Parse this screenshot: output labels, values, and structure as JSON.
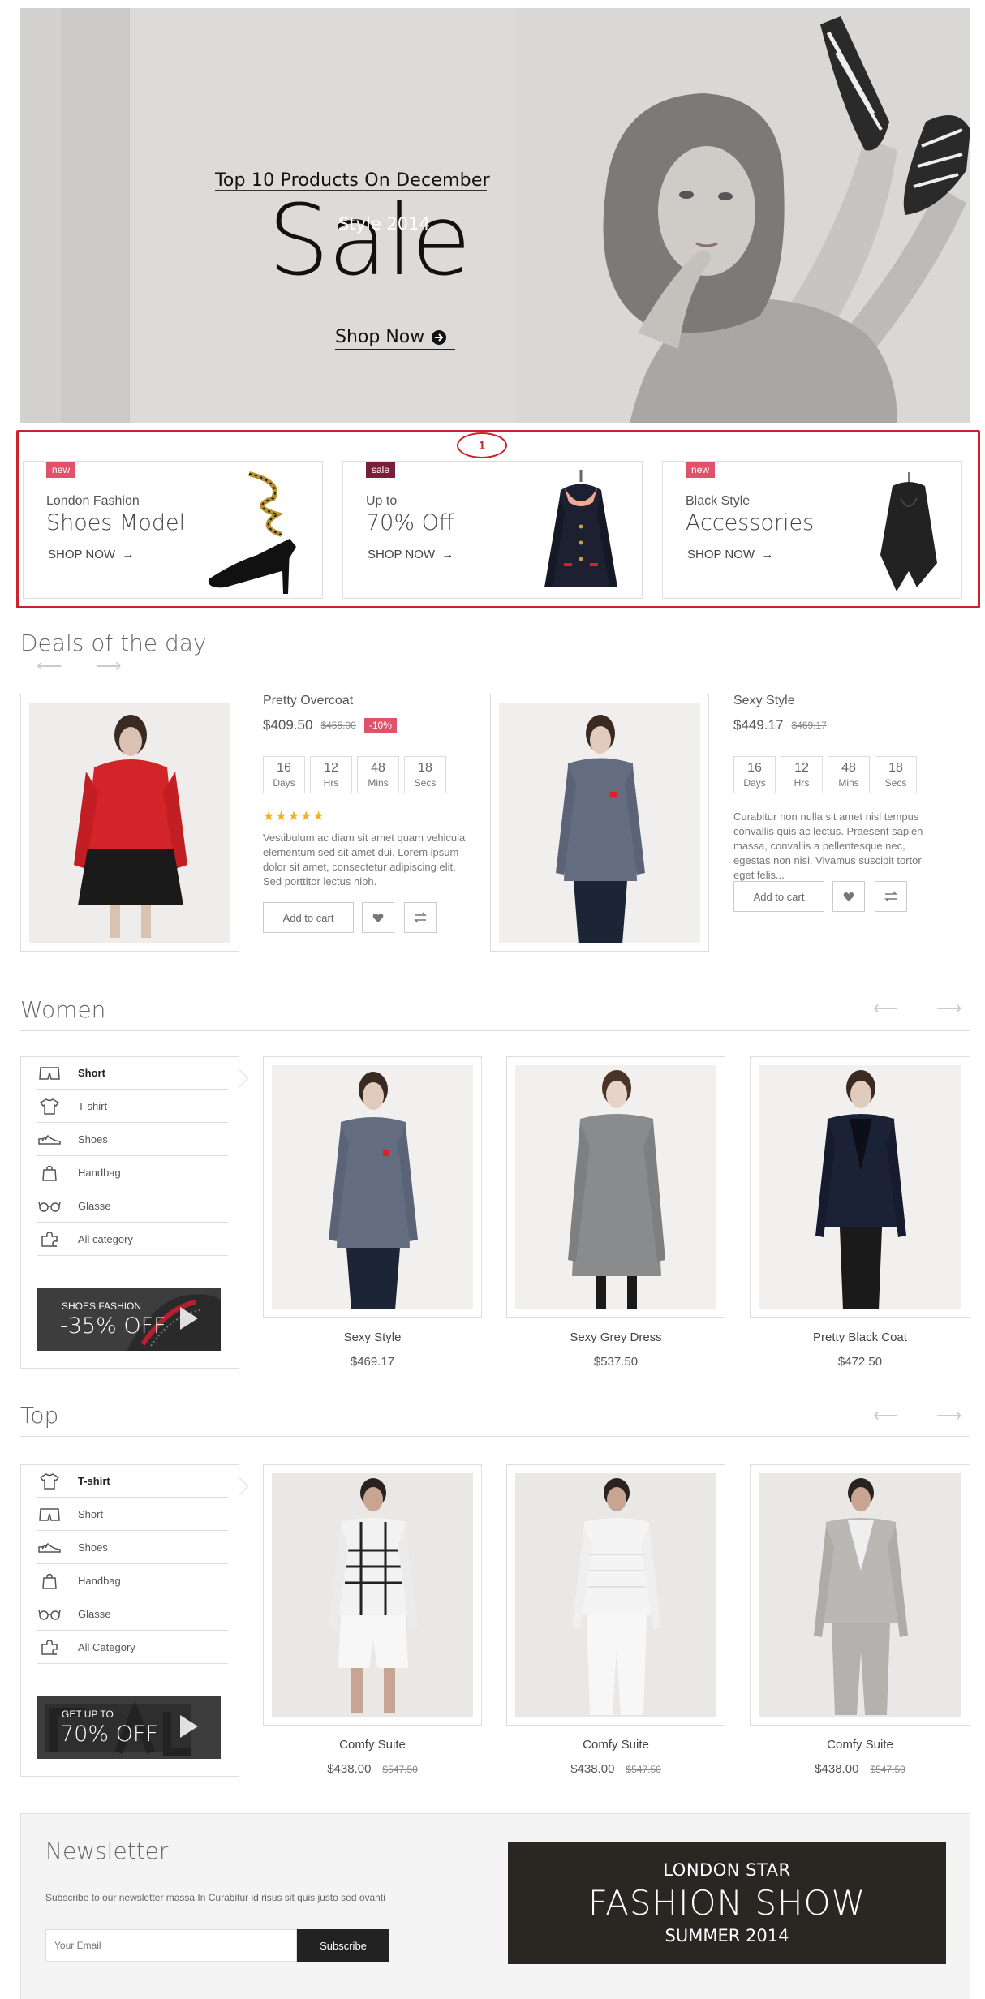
{
  "hero": {
    "top_line": "Top 10 Products On December",
    "subtitle": "Style 2014",
    "headline": "Sale",
    "cta": "Shop Now"
  },
  "annotation": {
    "marker": "1"
  },
  "promos": [
    {
      "tag": "new",
      "tag_color": "#e0526a",
      "small": "London Fashion",
      "big": "Shoes Model",
      "cta": "SHOP NOW",
      "icon": "heel-shoe-icon"
    },
    {
      "tag": "sale",
      "tag_color": "#7a1f3a",
      "small": "Up to",
      "big": "70% Off",
      "cta": "SHOP NOW",
      "icon": "coat-icon"
    },
    {
      "tag": "new",
      "tag_color": "#e0526a",
      "small": "Black Style",
      "big": "Accessories",
      "cta": "SHOP NOW",
      "icon": "scarf-icon"
    }
  ],
  "deals": {
    "title": "Deals of the day",
    "items": [
      {
        "name": "Pretty Overcoat",
        "price": "$409.50",
        "old_price": "$455.00",
        "discount": "-10%",
        "timer": [
          {
            "value": "16",
            "unit": "Days"
          },
          {
            "value": "12",
            "unit": "Hrs"
          },
          {
            "value": "48",
            "unit": "Mins"
          },
          {
            "value": "18",
            "unit": "Secs"
          }
        ],
        "rating": 5,
        "description": "Vestibulum ac diam sit amet quam vehicula elementum sed sit amet dui. Lorem ipsum dolor sit amet, consectetur adipiscing elit. Sed porttitor lectus nibh.",
        "add_to_cart": "Add to cart"
      },
      {
        "name": "Sexy Style",
        "price": "$449.17",
        "old_price": "$469.17",
        "timer": [
          {
            "value": "16",
            "unit": "Days"
          },
          {
            "value": "12",
            "unit": "Hrs"
          },
          {
            "value": "48",
            "unit": "Mins"
          },
          {
            "value": "18",
            "unit": "Secs"
          }
        ],
        "description": "Curabitur non nulla sit amet nisl tempus convallis quis ac lectus. Praesent sapien massa, convallis a pellentesque nec, egestas non nisi. Vivamus suscipit tortor eget felis...",
        "add_to_cart": "Add to cart"
      }
    ]
  },
  "women": {
    "title": "Women",
    "menu": [
      "Short",
      "T-shirt",
      "Shoes",
      "Handbag",
      "Glasse",
      "All category"
    ],
    "banner_small": "SHOES FASHION",
    "banner_big": "-35% OFF",
    "products": [
      {
        "name": "Sexy Style",
        "price": "$469.17"
      },
      {
        "name": "Sexy Grey Dress",
        "price": "$537.50"
      },
      {
        "name": "Pretty Black Coat",
        "price": "$472.50"
      }
    ]
  },
  "top": {
    "title": "Top",
    "menu": [
      "T-shirt",
      "Short",
      "Shoes",
      "Handbag",
      "Glasse",
      "All Category"
    ],
    "banner_small": "GET UP TO",
    "banner_big": "70% OFF",
    "products": [
      {
        "name": "Comfy Suite",
        "price": "$438.00",
        "old_price": "$547.50"
      },
      {
        "name": "Comfy Suite",
        "price": "$438.00",
        "old_price": "$547.50"
      },
      {
        "name": "Comfy Suite",
        "price": "$438.00",
        "old_price": "$547.50"
      }
    ]
  },
  "newsletter": {
    "title": "Newsletter",
    "text": "Subscribe to our newsletter massa In Curabitur id risus sit quis justo sed ovanti",
    "placeholder": "Your Email",
    "button": "Subscribe",
    "banner_l1": "LONDON STAR",
    "banner_l2": "FASHION SHOW",
    "banner_l3": "SUMMER 2014"
  }
}
